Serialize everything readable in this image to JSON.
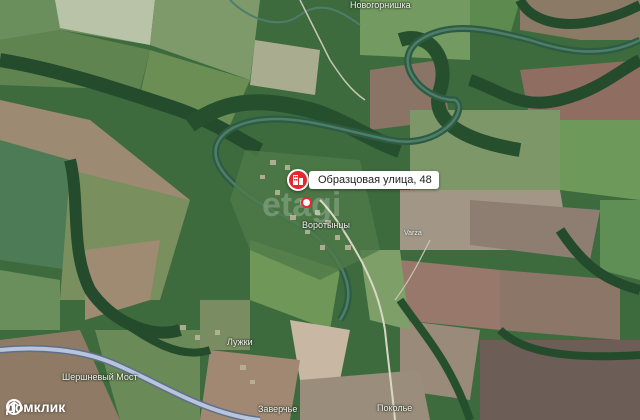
{
  "map": {
    "marker": {
      "address": "Образцовая улица, 48"
    },
    "watermark": "etagi",
    "places": [
      {
        "id": "vorotynschi",
        "label": "Воротынцы"
      },
      {
        "id": "luzhki",
        "label": "Лужки"
      },
      {
        "id": "shershny-most",
        "label": "Шершневый Мост"
      },
      {
        "id": "zaverchye",
        "label": "Заверчье"
      },
      {
        "id": "pokolye",
        "label": "Поколье"
      },
      {
        "id": "novogornishka",
        "label": "Новогорнишка"
      },
      {
        "id": "varza",
        "label": "Varza"
      }
    ],
    "colors": {
      "marker": "#e8262f",
      "forest": "#2f5e36",
      "road": "#8fa4c9"
    }
  },
  "brand": {
    "name": "домклик"
  }
}
